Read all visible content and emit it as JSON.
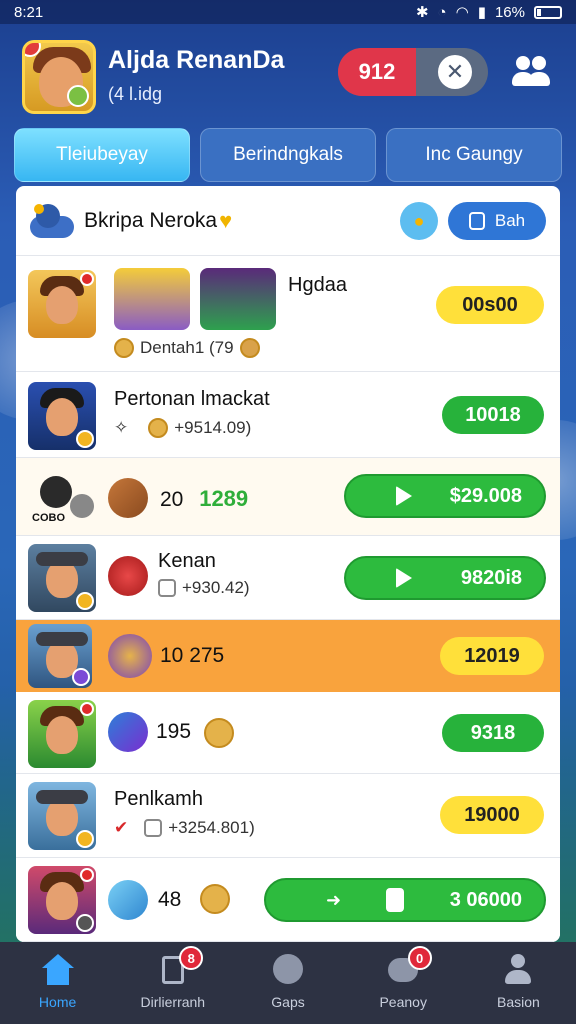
{
  "status_bar": {
    "time": "8:21",
    "battery": "16%"
  },
  "header": {
    "user_name": "Aljda RenanDa",
    "user_sub": "(4 l.idg",
    "score": "912",
    "close_symbol": "✕"
  },
  "tabs": [
    {
      "label": "Tleiubeyay",
      "active": true
    },
    {
      "label": "Berindngkals",
      "active": false
    },
    {
      "label": "Inc Gaungy",
      "active": false
    }
  ],
  "card": {
    "title": "Bkripa Neroka",
    "button_label": "Bah"
  },
  "rows": [
    {
      "name": "Hgdaa",
      "sub": "Dentah1 (79",
      "value": "00s00",
      "style": "yellow"
    },
    {
      "name": "Pertonan lmackat",
      "sub": "+9514.09)",
      "value": "10018",
      "style": "green"
    },
    {
      "number": "20",
      "number_green": "1289",
      "value": "$29.008",
      "style": "green-lg",
      "label": "COBO"
    },
    {
      "name": "Kenan",
      "sub": "+930.42)",
      "value": "9820i8",
      "style": "green-lg"
    },
    {
      "number": "10 275",
      "value": "12019",
      "style": "yellow"
    },
    {
      "number": "195",
      "value": "9318",
      "style": "green"
    },
    {
      "name": "Penlkamh",
      "sub": "+3254.801)",
      "value": "19000",
      "style": "yellow"
    },
    {
      "number": "48",
      "value": "3 06000",
      "style": "green-lg"
    }
  ],
  "nav": [
    {
      "label": "Home",
      "active": true
    },
    {
      "label": "Dirlierranh",
      "badge": "8"
    },
    {
      "label": "Gaps"
    },
    {
      "label": "Peanoy",
      "badge": "0"
    },
    {
      "label": "Basion"
    }
  ],
  "colors": {
    "accent_blue": "#37b6f2",
    "highlight_orange": "#f9a33d",
    "pill_yellow": "#ffe03a",
    "pill_green": "#27b23b",
    "score_red": "#e0364a"
  }
}
